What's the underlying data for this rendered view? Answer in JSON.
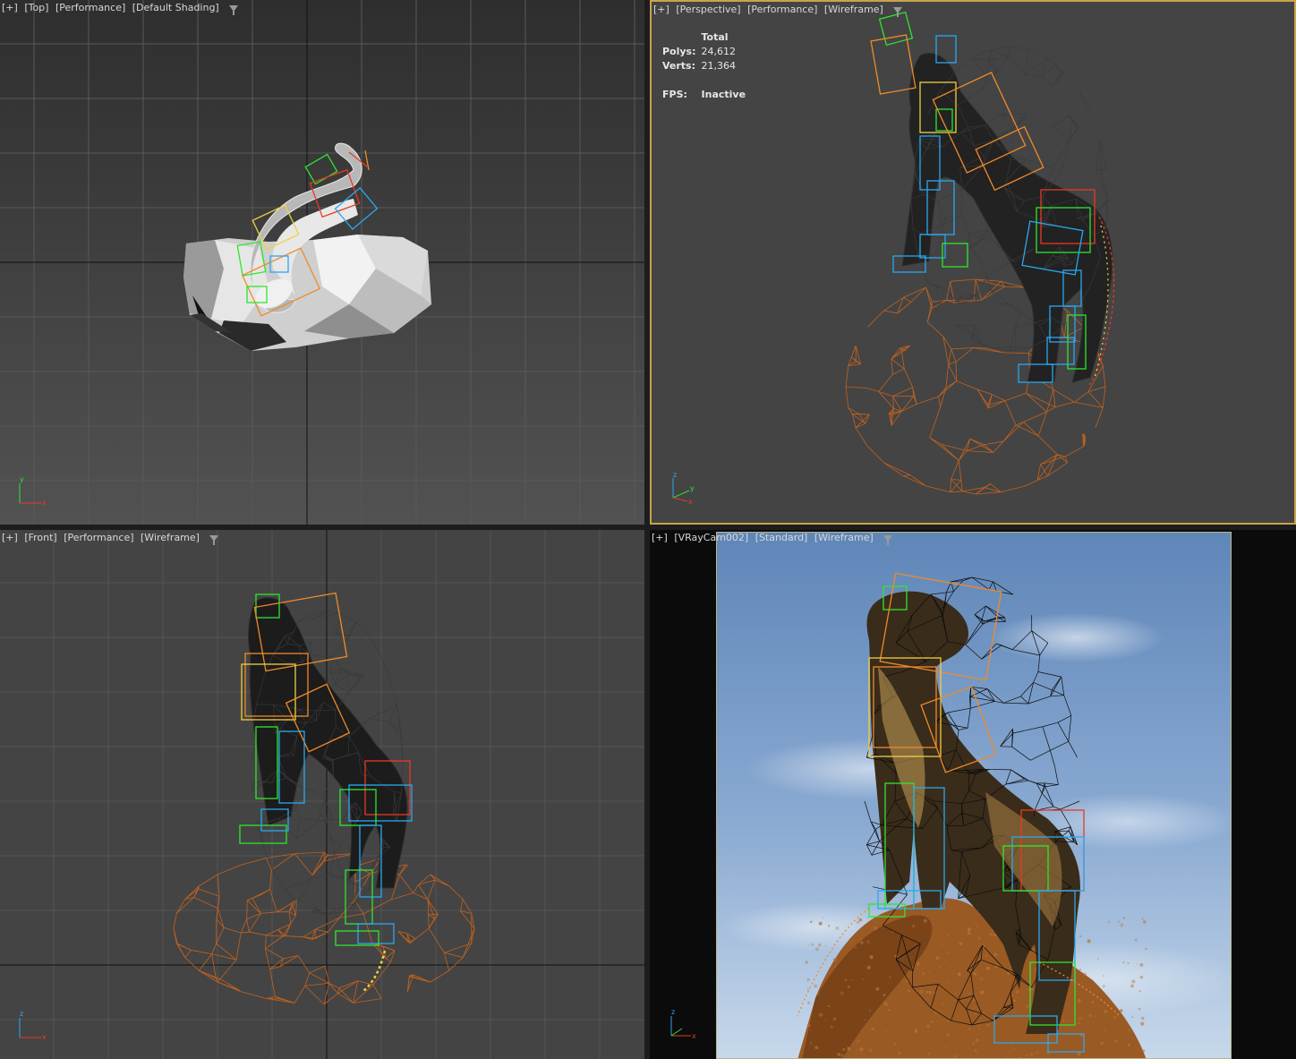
{
  "viewports": {
    "top": {
      "plus": "[+]",
      "view": "[Top]",
      "mode": "[Performance]",
      "shading": "[Default Shading]"
    },
    "persp": {
      "plus": "[+]",
      "view": "[Perspective]",
      "mode": "[Performance]",
      "shading": "[Wireframe]"
    },
    "front": {
      "plus": "[+]",
      "view": "[Front]",
      "mode": "[Performance]",
      "shading": "[Wireframe]"
    },
    "cam": {
      "plus": "[+]",
      "view": "[VRayCam002]",
      "mode": "[Standard]",
      "shading": "[Wireframe]"
    }
  },
  "stats": {
    "header": "Total",
    "polys_label": "Polys:",
    "polys_value": "24,612",
    "verts_label": "Verts:",
    "verts_value": "21,364",
    "fps_label": "FPS:",
    "fps_value": "Inactive"
  },
  "axes": {
    "x": "x",
    "y": "y",
    "z": "z"
  },
  "colors": {
    "active_border": "#c8a44a",
    "rock_wire": "#c2621e",
    "bone_green": "#2ee62e",
    "bone_blue": "#2aa8f0",
    "bone_orange": "#f08a2a",
    "bone_red": "#e83a22",
    "bone_yellow": "#f0d040",
    "mesh_dark": "#151515"
  }
}
